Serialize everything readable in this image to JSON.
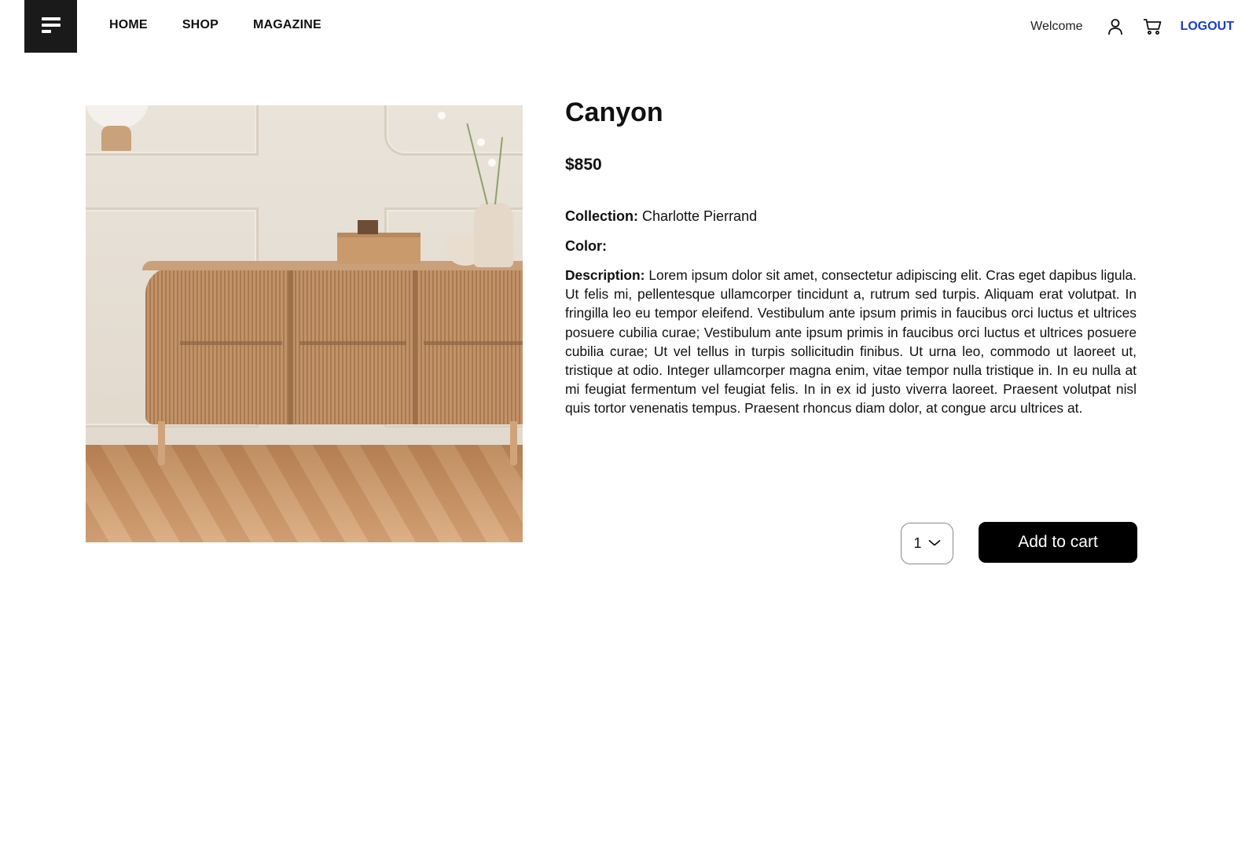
{
  "header": {
    "nav": [
      {
        "label": "HOME"
      },
      {
        "label": "SHOP"
      },
      {
        "label": "MAGAZINE"
      }
    ],
    "welcome_text": "Welcome",
    "icons": {
      "menu": "menu-icon",
      "user": "user-icon",
      "cart": "cart-icon"
    },
    "logout_label": "LOGOUT",
    "logout_color": "#1a3ccc"
  },
  "product": {
    "name": "Canyon",
    "price": "$850",
    "collection_label": "Collection:",
    "collection_value": "Charlotte Pierrand",
    "color_label": "Color:",
    "color_value": "",
    "description_label": "Description:",
    "description_text": "Lorem ipsum dolor sit amet, consectetur adipiscing elit. Cras eget dapibus ligula. Ut felis mi, pellentesque ullamcorper tincidunt a, rutrum sed turpis. Aliquam erat volutpat. In fringilla leo eu tempor eleifend. Vestibulum ante ipsum primis in faucibus orci luctus et ultrices posuere cubilia curae; Vestibulum ante ipsum primis in faucibus orci luctus et ultrices posuere cubilia curae; Ut vel tellus in turpis sollicitudin finibus. Ut urna leo, commodo ut laoreet ut, tristique at odio. Integer ullamcorper magna enim, vitae tempor nulla tristique in. In eu nulla at mi feugiat fermentum vel feugiat felis. In in ex id justo viverra laoreet. Praesent volutpat nisl quis tortor venenatis tempus. Praesent rhoncus diam dolor, at congue arcu ultrices at.",
    "quantity": "1",
    "add_to_cart_label": "Add to cart"
  }
}
